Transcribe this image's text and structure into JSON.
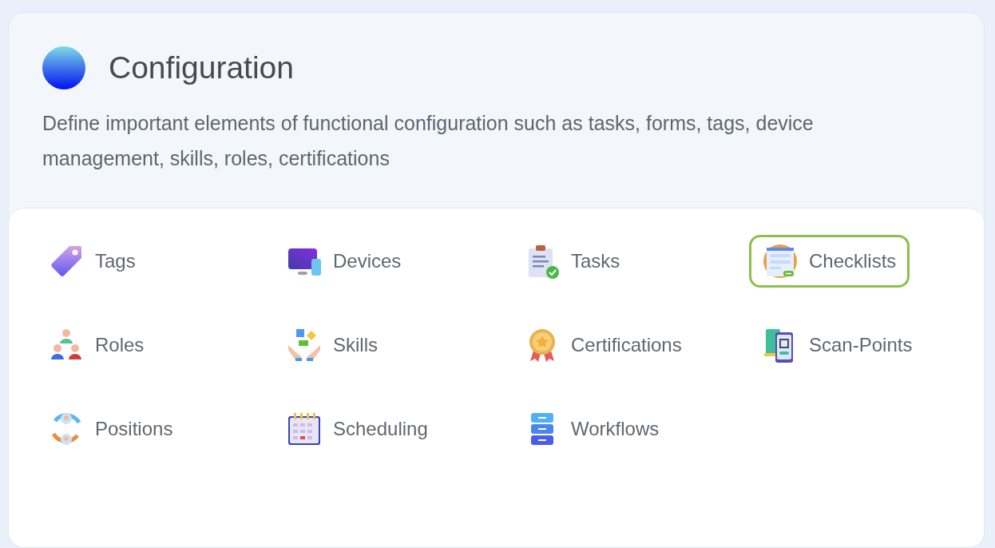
{
  "header": {
    "title": "Configuration",
    "description": "Define important elements of functional configuration such as tasks, forms, tags, device management, skills, roles, certifications"
  },
  "items": [
    {
      "kind": "tag",
      "label": "Tags",
      "selected": false
    },
    {
      "kind": "devices",
      "label": "Devices",
      "selected": false
    },
    {
      "kind": "tasks",
      "label": "Tasks",
      "selected": false
    },
    {
      "kind": "checklist",
      "label": "Checklists",
      "selected": true
    },
    {
      "kind": "roles",
      "label": "Roles",
      "selected": false
    },
    {
      "kind": "skills",
      "label": "Skills",
      "selected": false
    },
    {
      "kind": "certification",
      "label": "Certifications",
      "selected": false
    },
    {
      "kind": "scan",
      "label": "Scan-Points",
      "selected": false
    },
    {
      "kind": "positions",
      "label": "Positions",
      "selected": false
    },
    {
      "kind": "scheduling",
      "label": "Scheduling",
      "selected": false
    },
    {
      "kind": "workflows",
      "label": "Workflows",
      "selected": false
    }
  ]
}
